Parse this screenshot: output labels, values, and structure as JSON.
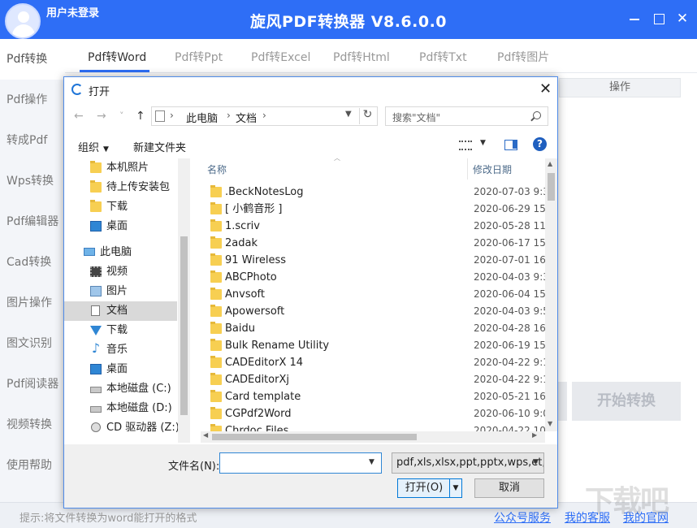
{
  "header": {
    "user_label": "用户未登录",
    "title": "旋风PDF转换器 V8.6.0.0",
    "close_glyph": "✕"
  },
  "sidebar": {
    "items": [
      {
        "label": "Pdf转换",
        "active": true
      },
      {
        "label": "Pdf操作"
      },
      {
        "label": "转成Pdf"
      },
      {
        "label": "Wps转换"
      },
      {
        "label": "Pdf编辑器"
      },
      {
        "label": "Cad转换"
      },
      {
        "label": "图片操作"
      },
      {
        "label": "图文识别"
      },
      {
        "label": "Pdf阅读器"
      },
      {
        "label": "视频转换"
      },
      {
        "label": "使用帮助"
      }
    ]
  },
  "tabs": [
    {
      "label": "Pdf转Word",
      "active": true
    },
    {
      "label": "Pdf转Ppt"
    },
    {
      "label": "Pdf转Excel"
    },
    {
      "label": "Pdf转Html"
    },
    {
      "label": "Pdf转Txt"
    },
    {
      "label": "Pdf转图片"
    }
  ],
  "main": {
    "column_header": "操作",
    "start_button": "开始转换"
  },
  "footer": {
    "tip": "提示:将文件转换为word能打开的格式",
    "links": [
      "公众号服务",
      "我的客服",
      "我的官网"
    ],
    "watermark": "下载吧"
  },
  "dialog": {
    "title": "打开",
    "close_glyph": "✕",
    "nav": {
      "back": "←",
      "forward": "→",
      "dropdown": "˅",
      "up": "↑"
    },
    "breadcrumb": [
      "此电脑",
      "文档"
    ],
    "breadcrumb_sep": "›",
    "refresh_glyph": "↻",
    "search_placeholder": "搜索\"文档\"",
    "toolbar": {
      "organize": "组织",
      "new_folder": "新建文件夹",
      "caret": "▼",
      "help": "?"
    },
    "navpane": [
      {
        "label": "本机照片",
        "icon": "folder-icon"
      },
      {
        "label": "待上传安装包",
        "icon": "folder-icon"
      },
      {
        "label": "下载",
        "icon": "folder-icon"
      },
      {
        "label": "桌面",
        "icon": "desktop-icon"
      },
      {
        "label": "此电脑",
        "icon": "pc-icon"
      },
      {
        "label": "视频",
        "icon": "video-icon"
      },
      {
        "label": "图片",
        "icon": "picture-icon"
      },
      {
        "label": "文档",
        "icon": "document-icon",
        "selected": true
      },
      {
        "label": "下载",
        "icon": "download-icon"
      },
      {
        "label": "音乐",
        "icon": "music-icon"
      },
      {
        "label": "桌面",
        "icon": "desktop-icon"
      },
      {
        "label": "本地磁盘 (C:)",
        "icon": "disk-icon"
      },
      {
        "label": "本地磁盘 (D:)",
        "icon": "disk-icon"
      },
      {
        "label": "CD 驱动器 (Z:)",
        "icon": "cd-icon"
      }
    ],
    "columns": {
      "name": "名称",
      "date": "修改日期"
    },
    "files": [
      {
        "name": ".BeckNotesLog",
        "date": "2020-07-03 9:3"
      },
      {
        "name": "[ 小鹤音形 ]",
        "date": "2020-06-29 15:"
      },
      {
        "name": "1.scriv",
        "date": "2020-05-28 11:"
      },
      {
        "name": "2adak",
        "date": "2020-06-17 15:"
      },
      {
        "name": "91 Wireless",
        "date": "2020-07-01 16:"
      },
      {
        "name": "ABCPhoto",
        "date": "2020-04-03 9:3"
      },
      {
        "name": "Anvsoft",
        "date": "2020-06-04 15:"
      },
      {
        "name": "Apowersoft",
        "date": "2020-04-03 9:5"
      },
      {
        "name": "Baidu",
        "date": "2020-04-28 16:"
      },
      {
        "name": "Bulk Rename Utility",
        "date": "2020-06-19 15:"
      },
      {
        "name": "CADEditorX 14",
        "date": "2020-04-22 9:1"
      },
      {
        "name": "CADEditorXj",
        "date": "2020-04-22 9:1"
      },
      {
        "name": "Card template",
        "date": "2020-05-21 16:"
      },
      {
        "name": "CGPdf2Word",
        "date": "2020-06-10 9:0"
      },
      {
        "name": "Chrdoc Files",
        "date": "2020-04-22 10:"
      }
    ],
    "filename_label": "文件名(N):",
    "filename_value": "",
    "filter_value": "pdf,xls,xlsx,ppt,pptx,wps,et,d",
    "open_button": "打开(O)",
    "cancel_button": "取消"
  }
}
